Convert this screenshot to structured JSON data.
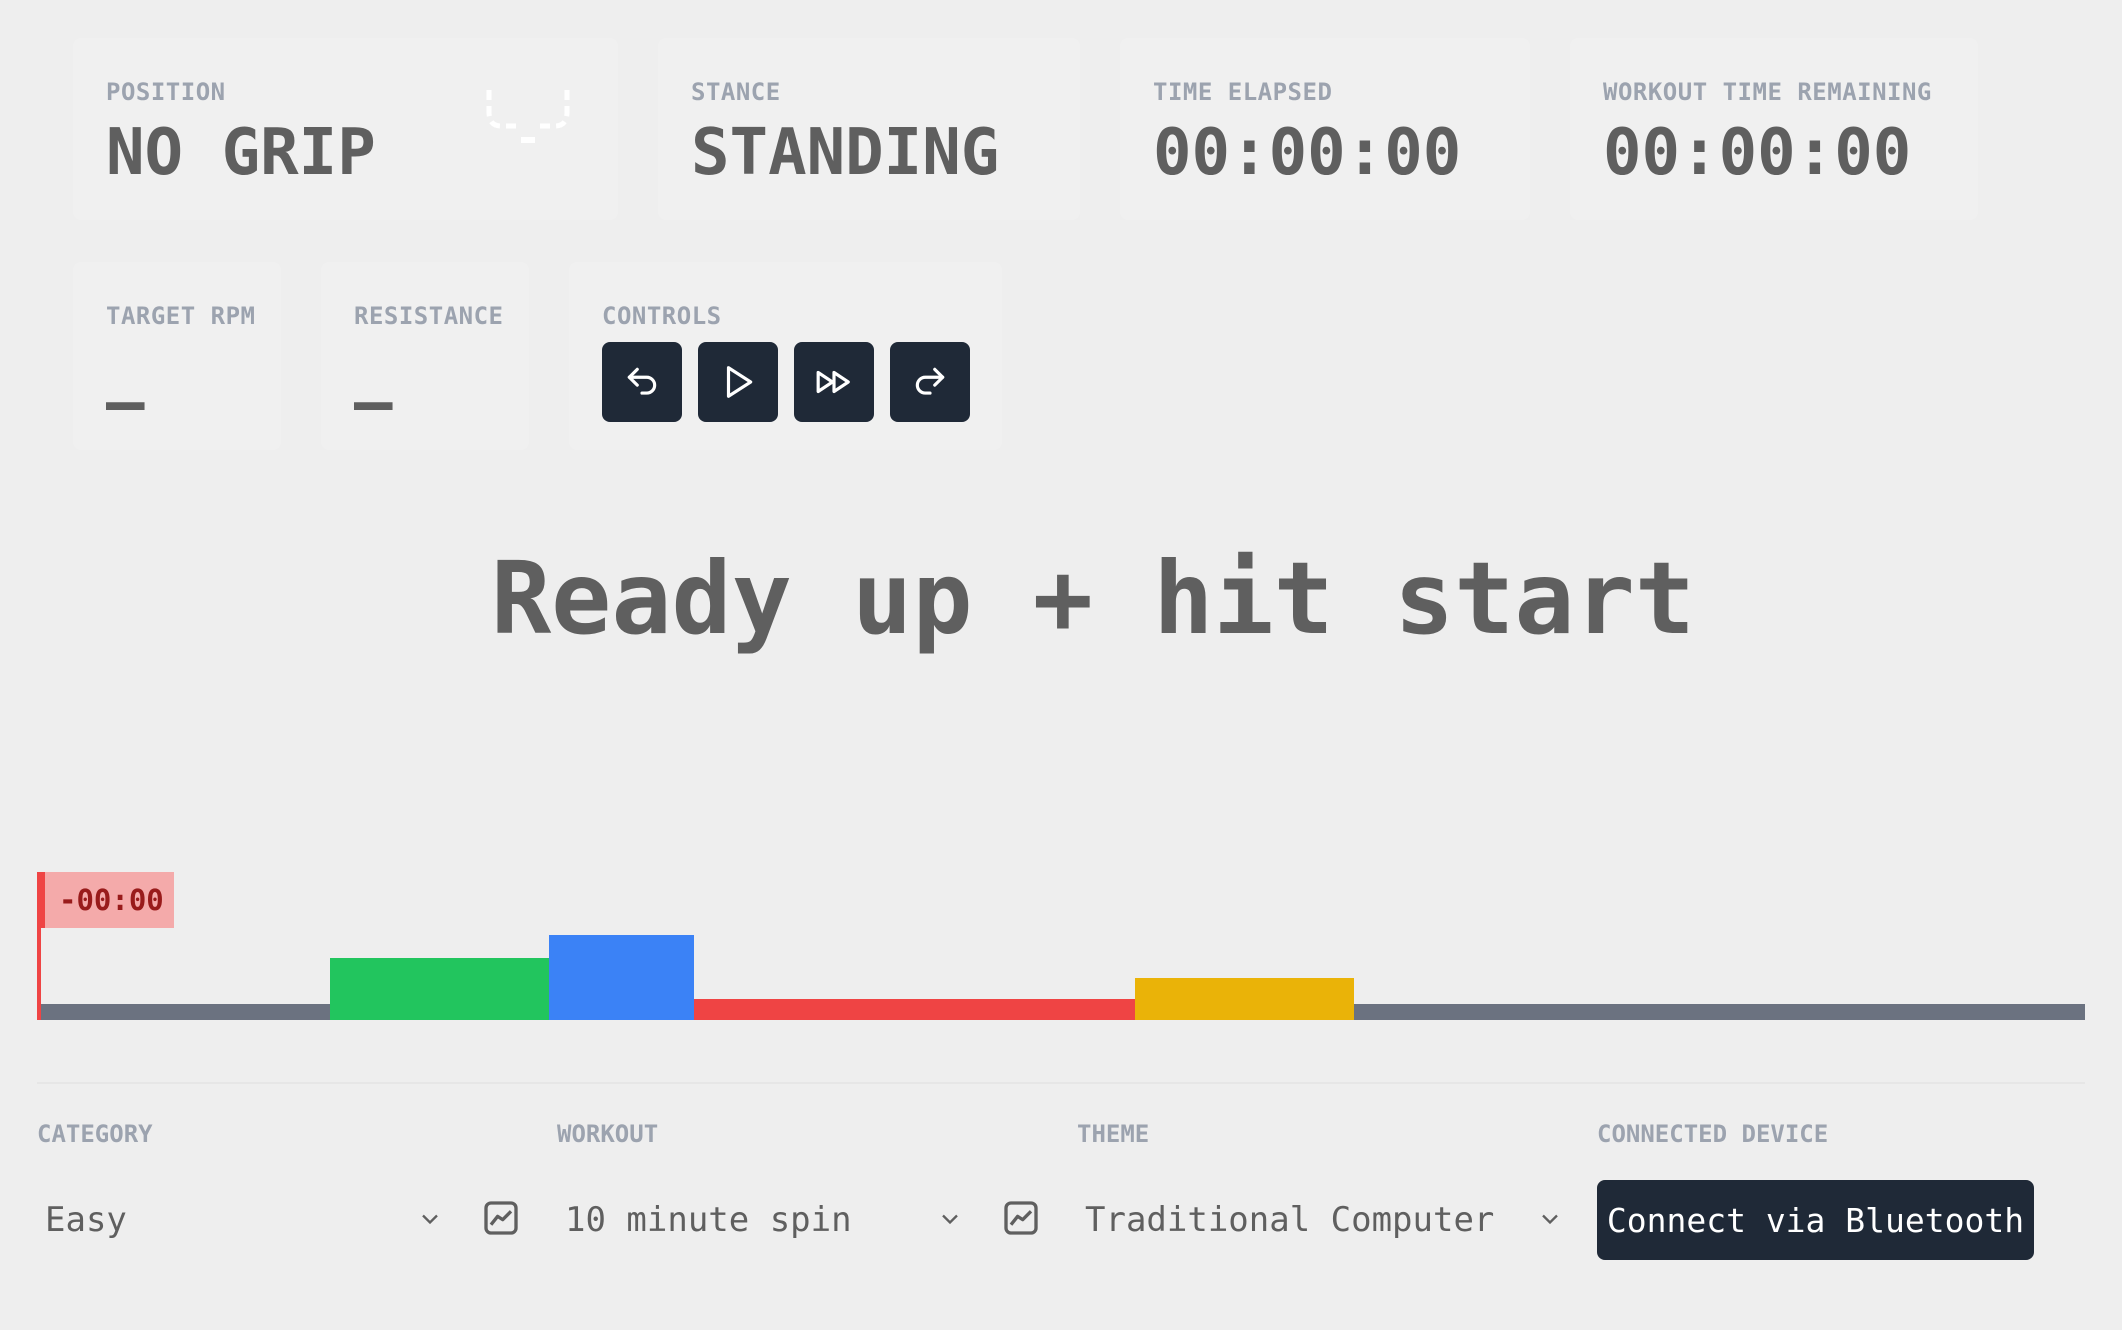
{
  "stats": {
    "position": {
      "label": "POSITION",
      "value": "NO GRIP"
    },
    "stance": {
      "label": "STANCE",
      "value": "STANDING"
    },
    "time_elapsed": {
      "label": "TIME ELAPSED",
      "value": "00:00:00"
    },
    "time_remaining": {
      "label": "WORKOUT TIME REMAINING",
      "value": "00:00:00"
    },
    "target_rpm": {
      "label": "TARGET RPM",
      "value": "–"
    },
    "resistance": {
      "label": "RESISTANCE",
      "value": "–"
    },
    "controls": {
      "label": "CONTROLS"
    }
  },
  "controls": {
    "buttons": [
      {
        "name": "restart-button",
        "icon": "undo-arrow-icon"
      },
      {
        "name": "play-button",
        "icon": "play-icon"
      },
      {
        "name": "skip-button",
        "icon": "fast-forward-icon"
      },
      {
        "name": "redo-button",
        "icon": "redo-arrow-icon"
      }
    ]
  },
  "headline": "Ready up + hit start",
  "timeline": {
    "countdown": "-00:00",
    "progress": 0,
    "segments": [
      {
        "start": 0.0,
        "end": 0.143,
        "level": 0.15,
        "color": "#6b7280"
      },
      {
        "start": 0.143,
        "end": 0.25,
        "level": 0.6,
        "color": "#22c55e"
      },
      {
        "start": 0.25,
        "end": 0.321,
        "level": 0.82,
        "color": "#3b82f6"
      },
      {
        "start": 0.321,
        "end": 0.536,
        "level": 0.2,
        "color": "#ef4444"
      },
      {
        "start": 0.536,
        "end": 0.643,
        "level": 0.4,
        "color": "#eab308"
      },
      {
        "start": 0.643,
        "end": 1.0,
        "level": 0.15,
        "color": "#6b7280"
      }
    ]
  },
  "settings": {
    "category": {
      "label": "CATEGORY",
      "value": "Easy"
    },
    "workout": {
      "label": "WORKOUT",
      "value": "10 minute spin"
    },
    "theme": {
      "label": "THEME",
      "value": "Traditional Computer"
    },
    "device": {
      "label": "CONNECTED DEVICE",
      "button_label": "Connect via Bluetooth"
    }
  },
  "colors": {
    "background": "#eeeeee",
    "card": "#f0f0f0",
    "dark_button": "#1f2937",
    "label": "#9ca3af",
    "text": "#5f5f5f"
  }
}
